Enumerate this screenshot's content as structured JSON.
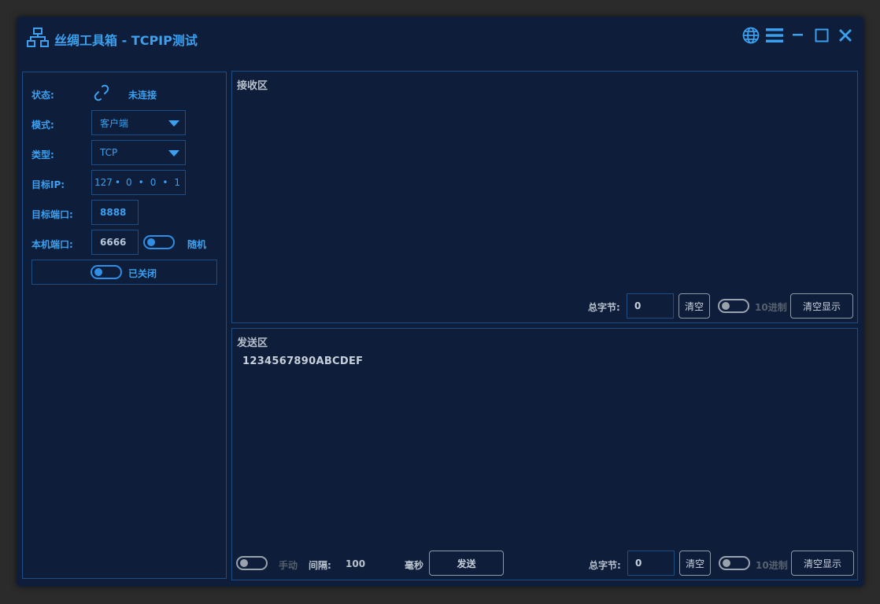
{
  "window": {
    "title": "丝绸工具箱 - TCPIP测试"
  },
  "titlebar_icons": [
    "globe-icon",
    "menu-icon",
    "minimize-icon",
    "maximize-icon",
    "close-icon"
  ],
  "config": {
    "status_label": "状态:",
    "status_value": "未连接",
    "mode_label": "模式:",
    "mode_value": "客户端",
    "type_label": "类型:",
    "type_value": "TCP",
    "target_ip_label": "目标IP:",
    "ip_parts": [
      "127",
      "0",
      "0",
      "1"
    ],
    "target_port_label": "目标端口:",
    "target_port": "8888",
    "local_port_label": "本机端口:",
    "local_port": "6666",
    "random_label": "随机",
    "power_label": "已关闭"
  },
  "receive": {
    "title": "接收区",
    "total_bytes_label": "总字节:",
    "total_bytes": "0",
    "clear_label": "清空",
    "hex_label": "10进制",
    "clear_display_label": "清空显示"
  },
  "send": {
    "title": "发送区",
    "content": "1234567890ABCDEF",
    "manual_label": "手动",
    "interval_label": "间隔:",
    "interval_value": "100",
    "ms_label": "毫秒",
    "send_label": "发送",
    "total_bytes_label": "总字节:",
    "total_bytes": "0",
    "clear_label": "清空",
    "hex_label": "10进制",
    "clear_display_label": "清空显示"
  },
  "colors": {
    "background": "#0e1d39",
    "accent": "#3aa0ef",
    "border": "#1e4d86"
  }
}
